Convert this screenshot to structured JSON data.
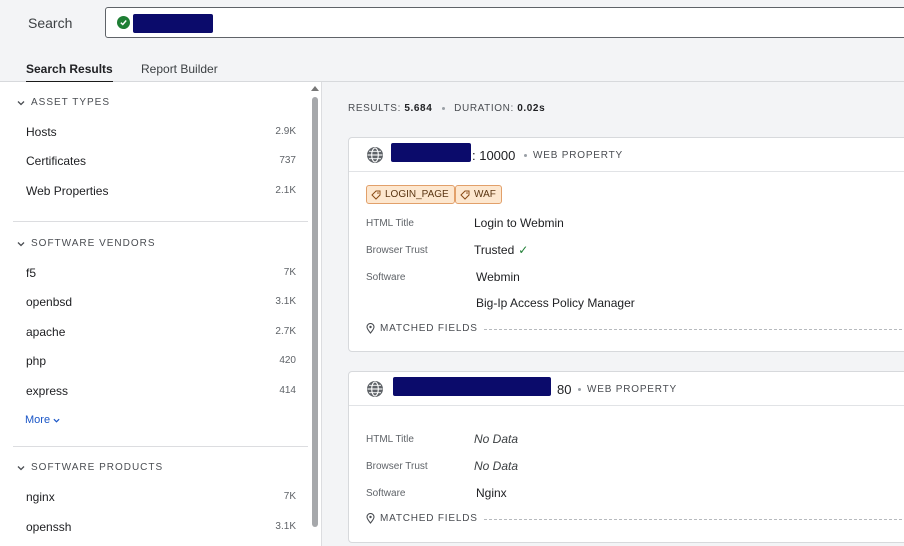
{
  "search": {
    "label": "Search",
    "status_icon": "check-circle-icon",
    "status_color": "#1e7e34",
    "query_redacted": true
  },
  "tabs": [
    {
      "label": "Search Results",
      "active": true
    },
    {
      "label": "Report Builder",
      "active": false
    }
  ],
  "sidebar": {
    "asset_types": {
      "title": "ASSET TYPES",
      "items": [
        {
          "label": "Hosts",
          "count": "2.9K"
        },
        {
          "label": "Certificates",
          "count": "737"
        },
        {
          "label": "Web Properties",
          "count": "2.1K"
        }
      ]
    },
    "software_vendors": {
      "title": "SOFTWARE VENDORS",
      "items": [
        {
          "label": "f5",
          "count": "7K"
        },
        {
          "label": "openbsd",
          "count": "3.1K"
        },
        {
          "label": "apache",
          "count": "2.7K"
        },
        {
          "label": "php",
          "count": "420"
        },
        {
          "label": "express",
          "count": "414"
        }
      ],
      "more_label": "More"
    },
    "software_products": {
      "title": "SOFTWARE PRODUCTS",
      "items": [
        {
          "label": "nginx",
          "count": "7K"
        },
        {
          "label": "openssh",
          "count": "3.1K"
        }
      ]
    }
  },
  "summary": {
    "results_label": "RESULTS:",
    "results_value": "5.684",
    "duration_label": "DURATION:",
    "duration_value": "0.02s"
  },
  "results": [
    {
      "port": ": 10000",
      "kind": "WEB PROPERTY",
      "tags": [
        "LOGIN_PAGE",
        "WAF"
      ],
      "fields": {
        "html_title_label": "HTML Title",
        "html_title": "Login to Webmin",
        "browser_trust_label": "Browser Trust",
        "browser_trust": "Trusted",
        "software_label": "Software",
        "software": [
          "Webmin",
          "Big-Ip Access Policy Manager"
        ]
      },
      "matched_label": "MATCHED FIELDS"
    },
    {
      "port": "80",
      "kind": "WEB PROPERTY",
      "tags": [],
      "fields": {
        "html_title_label": "HTML Title",
        "html_title": "No Data",
        "browser_trust_label": "Browser Trust",
        "browser_trust": "No Data",
        "software_label": "Software",
        "software": [
          "Nginx"
        ]
      },
      "matched_label": "MATCHED FIELDS"
    }
  ],
  "colors": {
    "accent_link": "#1a56c7",
    "tag_bg": "#fde7cf",
    "tag_border": "#e2a06a",
    "redaction": "#0b0b6b"
  }
}
